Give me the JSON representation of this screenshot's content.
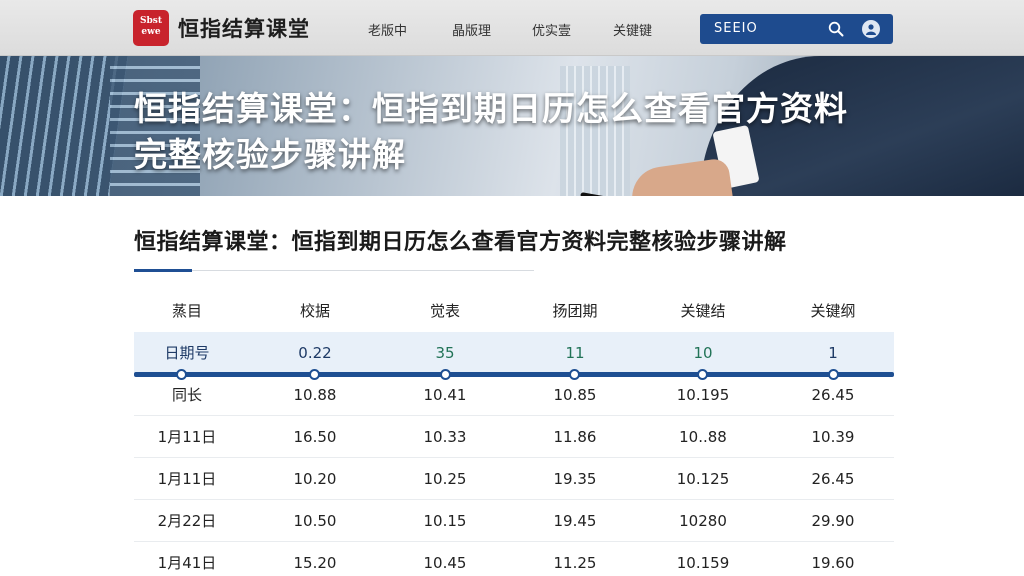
{
  "header": {
    "logo_line1": "Sbst",
    "logo_line2": "ewe",
    "site_title": "恒指结算课堂",
    "nav": [
      "老版中",
      "晶版理",
      "优实壹",
      "关键键"
    ],
    "search_text": "SEEIO"
  },
  "banner": {
    "title_line1": "恒指结算课堂：恒指到期日历怎么查看官方资料",
    "title_line2": "完整核验步骤讲解"
  },
  "article": {
    "title": "恒指结算课堂：恒指到期日历怎么查看官方资料完整核验步骤讲解"
  },
  "table": {
    "headers": [
      "蒸目",
      "校据",
      "觉表",
      "扬团期",
      "关键结",
      "关键纲"
    ],
    "highlight_row": [
      "日期号",
      "0.22",
      "35",
      "11",
      "10",
      "1"
    ],
    "rows": [
      [
        "同长",
        "10.88",
        "10.41",
        "10.85",
        "10.195",
        "26.45"
      ],
      [
        "1月11日",
        "16.50",
        "10.33",
        "11.86",
        "10..88",
        "10.39"
      ],
      [
        "1月11日",
        "10.20",
        "10.25",
        "19.35",
        "10.125",
        "26.45"
      ],
      [
        "2月22日",
        "10.50",
        "10.15",
        "19.45",
        "10280",
        "29.90"
      ],
      [
        "1月41日",
        "15.20",
        "10.45",
        "11.25",
        "10.159",
        "19.60"
      ]
    ]
  },
  "colors": {
    "accent": "#1e4f92",
    "logo_red": "#c8232c",
    "highlight_bg": "#e8f0f9"
  }
}
